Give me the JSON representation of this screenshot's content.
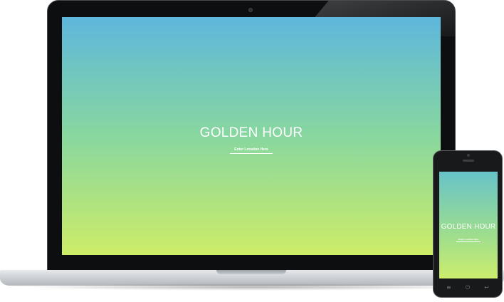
{
  "laptop": {
    "app": {
      "title": "GOLDEN HOUR",
      "link_label": "Enter Location Here"
    }
  },
  "phone": {
    "app": {
      "title": "GOLDEN HOUR",
      "link_label": "Enter Location Here"
    },
    "nav": {
      "menu_icon": "≡",
      "power_icon": "⏻",
      "back_icon": "↩"
    }
  }
}
